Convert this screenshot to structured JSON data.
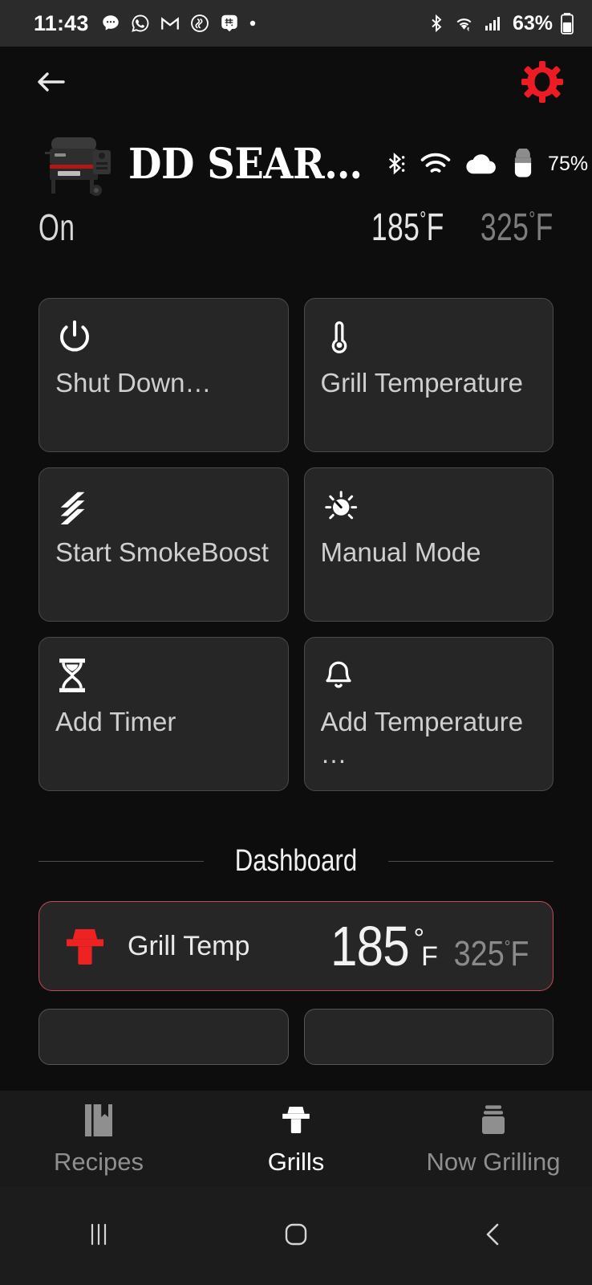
{
  "status_bar": {
    "time": "11:43",
    "left_icons": [
      "messages-icon",
      "whatsapp-icon",
      "gmail-icon",
      "smoke-app-icon",
      "smiley-icon",
      "dot-icon"
    ],
    "right_icons": [
      "bluetooth-icon",
      "wifi-icon",
      "cellular-signal-icon"
    ],
    "battery_percent": "63%"
  },
  "app_bar": {
    "back_icon": "back-arrow-icon",
    "settings_icon": "gear-icon",
    "settings_color": "#ed1c24"
  },
  "grill_header": {
    "thumbnail": "grill-thumbnail",
    "name": "DD SEAR…",
    "connectivity": [
      "bluetooth-icon",
      "wifi-icon",
      "cloud-icon"
    ],
    "hopper_icon": "pellet-hopper-icon",
    "hopper_level": "75%"
  },
  "grill_state": {
    "power_status": "On",
    "current_temp": "185",
    "current_unit": "F",
    "target_temp": "325",
    "target_unit": "F",
    "degree": "°"
  },
  "actions": [
    {
      "icon": "power-icon",
      "label": "Shut Down…"
    },
    {
      "icon": "thermometer-icon",
      "label": "Grill Temperature"
    },
    {
      "icon": "smoke-lines-icon",
      "label": "Start SmokeBoost"
    },
    {
      "icon": "dial-knob-icon",
      "label": "Manual Mode"
    },
    {
      "icon": "hourglass-icon",
      "label": "Add Timer"
    },
    {
      "icon": "bell-icon",
      "label": "Add Temperature …"
    }
  ],
  "dashboard": {
    "title": "Dashboard",
    "probe": {
      "icon": "grill-icon",
      "icon_color": "#ee2222",
      "border_color": "#c44a55",
      "name": "Grill Temp",
      "current": "185",
      "degree": "°",
      "unit": "F",
      "target": "325",
      "target_unit": "F"
    }
  },
  "tabs": [
    {
      "icon": "recipe-book-icon",
      "label": "Recipes",
      "active": false
    },
    {
      "icon": "grill-icon",
      "label": "Grills",
      "active": true
    },
    {
      "icon": "stack-icon",
      "label": "Now Grilling",
      "active": false
    }
  ],
  "system_nav": {
    "recents_icon": "recents-icon",
    "home_icon": "home-icon",
    "back_icon": "back-chevron-icon"
  }
}
